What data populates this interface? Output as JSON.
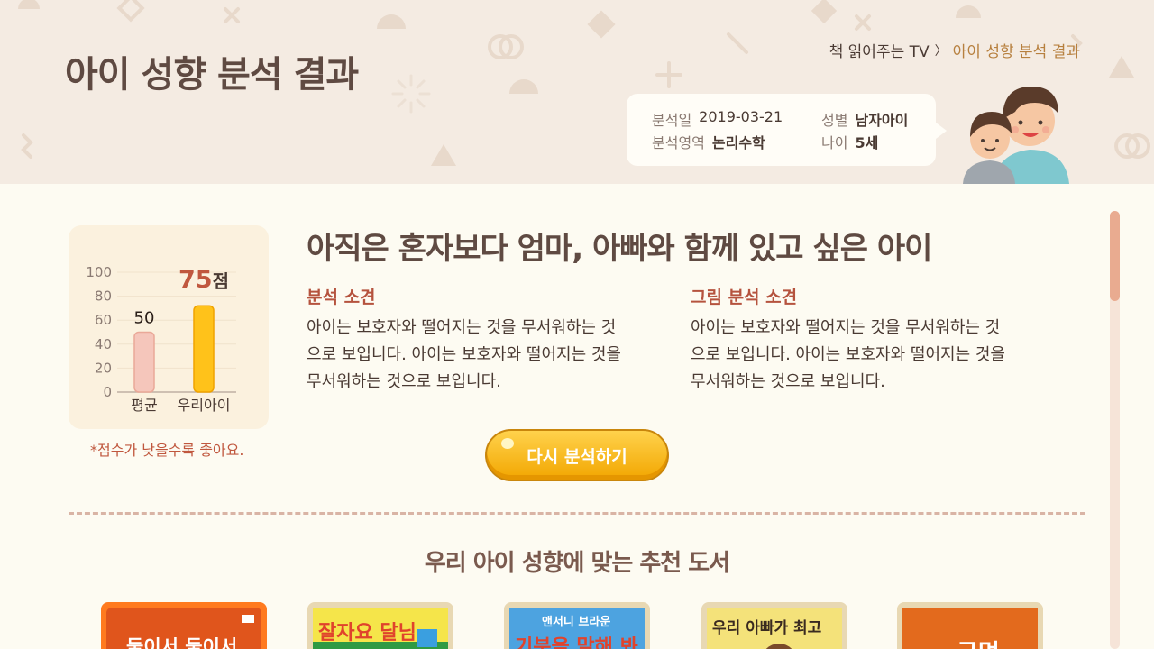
{
  "header": {
    "title": "아이 성향 분석 결과",
    "breadcrumb": {
      "parent": "책 읽어주는 TV",
      "separator": "〉",
      "current": "아이 성향 분석 결과"
    }
  },
  "info": {
    "date_label": "분석일",
    "date_value": "2019-03-21",
    "gender_label": "성별",
    "gender_value": "남자아이",
    "area_label": "분석영역",
    "area_value": "논리수학",
    "age_label": "나이",
    "age_value": "5세"
  },
  "chart_data": {
    "type": "bar",
    "categories": [
      "평균",
      "우리아이"
    ],
    "values": [
      50,
      72
    ],
    "data_labels": [
      "50",
      "75"
    ],
    "unit": "점",
    "yticks": [
      "100",
      "80",
      "60",
      "40",
      "20",
      "0"
    ],
    "ylim": [
      0,
      100
    ],
    "colors": {
      "average": "#f5c6bb",
      "child": "#ffc21a",
      "child_label": "#c0573e"
    }
  },
  "score_note": "*점수가 낮을수록 좋아요.",
  "result": {
    "headline": "아직은 혼자보다 엄마, 아빠와 함께 있고 싶은 아이",
    "analysis_title": "분석 소견",
    "analysis_lines": [
      "아이는 보호자와 떨어지는 것을 무서워하는 것",
      "으로 보입니다. 아이는 보호자와 떨어지는 것을",
      "무서워하는 것으로 보입니다."
    ],
    "drawing_title": "그림 분석 소견",
    "drawing_lines": [
      "아이는 보호자와 떨어지는 것을 무서워하는 것",
      "으로 보입니다. 아이는 보호자와 떨어지는 것을",
      "무서워하는 것으로 보입니다."
    ]
  },
  "retry_button": "다시 분석하기",
  "recommend": {
    "title": "우리 아이 성향에 맞는 추천 도서",
    "books": [
      {
        "title": "둘이서 둘이서",
        "icon": "book-cover-1"
      },
      {
        "title": "잘자요 달님",
        "icon": "book-cover-2"
      },
      {
        "top": "앤서니 브라운",
        "title": "기분을 말해 봐",
        "icon": "book-cover-3"
      },
      {
        "title": "우리 아빠가 최고",
        "icon": "book-cover-4"
      },
      {
        "title": "구멍",
        "icon": "book-cover-5"
      }
    ]
  },
  "colors": {
    "accent": "#b5533e",
    "breadcrumb_current": "#b7803f",
    "header_bg": "#f4ebe2",
    "page_bg": "#fdfbf2",
    "button": "#f7b714"
  }
}
